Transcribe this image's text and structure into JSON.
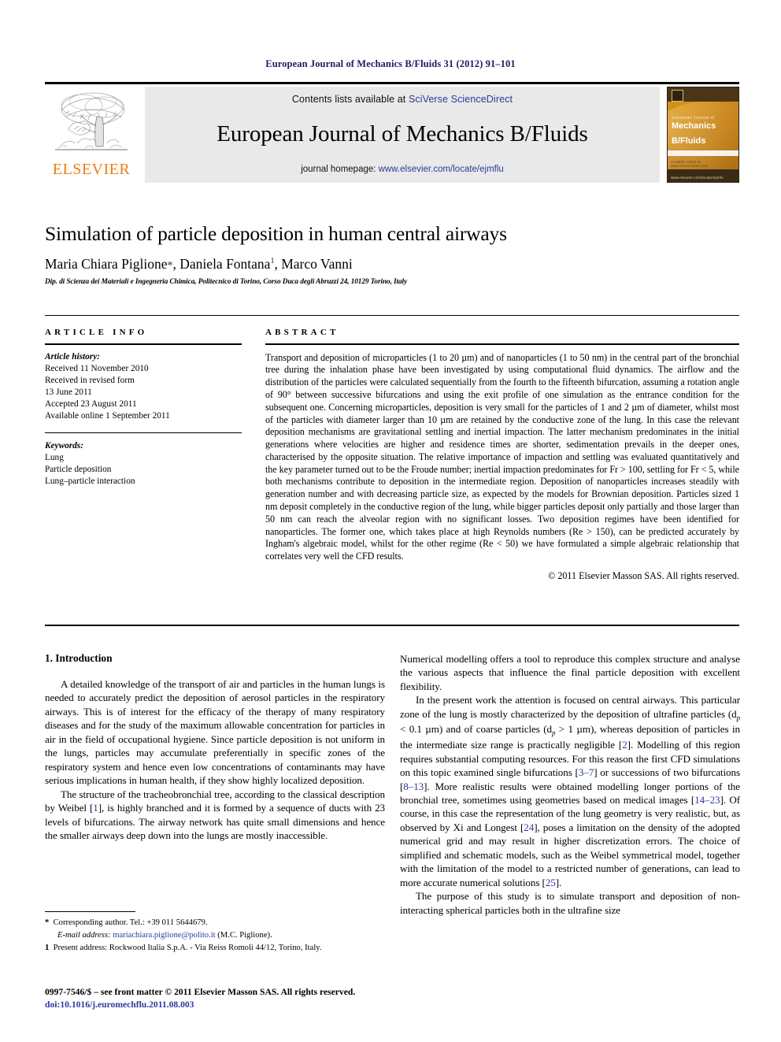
{
  "running_head": "European Journal of Mechanics B/Fluids 31 (2012) 91–101",
  "header": {
    "publisher_wordmark": "ELSEVIER",
    "contents_prefix": "Contents lists available at ",
    "contents_link": "SciVerse ScienceDirect",
    "journal_title": "European Journal of Mechanics B/Fluids",
    "homepage_prefix": "journal homepage: ",
    "homepage_link": "www.elsevier.com/locate/ejmflu",
    "cover": {
      "line1": "European Journal of",
      "line2": "Mechanics",
      "line3": "B/Fluids",
      "foot_small": "www.elsevier.com/locate/ejmflu",
      "foot_tiny": "Available online at www.sciencedirect.com"
    },
    "link_color": "#2b3a9c",
    "elsevier_orange": "#ef7d12",
    "banner_bg": "#e9e9e9"
  },
  "title": "Simulation of particle deposition in human central airways",
  "authors": {
    "a1": "Maria Chiara Piglione",
    "a1_mark": "*",
    "a2": "Daniela Fontana",
    "a2_mark": "1",
    "a3": "Marco Vanni"
  },
  "affiliation": "Dip. di Scienza dei Materiali e Ingegneria Chimica, Politecnico di Torino, Corso Duca degli Abruzzi 24, 10129 Torino, Italy",
  "article_info": {
    "label": "ARTICLE INFO",
    "history_label": "Article history:",
    "history": [
      "Received 11 November 2010",
      "Received in revised form",
      "13 June 2011",
      "Accepted 23 August 2011",
      "Available online 1 September 2011"
    ],
    "keywords_label": "Keywords:",
    "keywords": [
      "Lung",
      "Particle deposition",
      "Lung–particle interaction"
    ]
  },
  "abstract": {
    "label": "ABSTRACT",
    "text": "Transport and deposition of microparticles (1 to 20 µm) and of nanoparticles (1 to 50 nm) in the central part of the bronchial tree during the inhalation phase have been investigated by using computational fluid dynamics. The airflow and the distribution of the particles were calculated sequentially from the fourth to the fifteenth bifurcation, assuming a rotation angle of 90° between successive bifurcations and using the exit profile of one simulation as the entrance condition for the subsequent one. Concerning microparticles, deposition is very small for the particles of 1 and 2 µm of diameter, whilst most of the particles with diameter larger than 10 µm are retained by the conductive zone of the lung. In this case the relevant deposition mechanisms are gravitational settling and inertial impaction. The latter mechanism predominates in the initial generations where velocities are higher and residence times are shorter, sedimentation prevails in the deeper ones, characterised by the opposite situation. The relative importance of impaction and settling was evaluated quantitatively and the key parameter turned out to be the Froude number; inertial impaction predominates for Fr > 100, settling for Fr < 5, while both mechanisms contribute to deposition in the intermediate region. Deposition of nanoparticles increases steadily with generation number and with decreasing particle size, as expected by the models for Brownian deposition. Particles sized 1 nm deposit completely in the conductive region of the lung, while bigger particles deposit only partially and those larger than 50 nm can reach the alveolar region with no significant losses. Two deposition regimes have been identified for nanoparticles. The former one, which takes place at high Reynolds numbers (Re > 150), can be predicted accurately by Ingham's algebraic model, whilst for the other regime (Re < 50) we have formulated a simple algebraic relationship that correlates very well the CFD results.",
    "copyright": "© 2011 Elsevier Masson SAS. All rights reserved."
  },
  "body": {
    "section_heading": "1. Introduction",
    "left_p1": "A detailed knowledge of the transport of air and particles in the human lungs is needed to accurately predict the deposition of aerosol particles in the respiratory airways. This is of interest for the efficacy of the therapy of many respiratory diseases and for the study of the maximum allowable concentration for particles in air in the field of occupational hygiene. Since particle deposition is not uniform in the lungs, particles may accumulate preferentially in specific zones of the respiratory system and hence even low concentrations of contaminants may have serious implications in human health, if they show highly localized deposition.",
    "left_p2_a": "The structure of the tracheobronchial tree, according to the classical description by Weibel [",
    "left_p2_ref1": "1",
    "left_p2_b": "], is highly branched and it is formed by a sequence of ducts with 23 levels of bifurcations. The airway network has quite small dimensions and hence the smaller airways deep down into the lungs are mostly inaccessible.",
    "right_p1": "Numerical modelling offers a tool to reproduce this complex structure and analyse the various aspects that influence the final particle deposition with excellent flexibility.",
    "right_p2_a": "In the present work the attention is focused on central airways. This particular zone of the lung is mostly characterized by the deposition of ultrafine particles (d",
    "right_p2_sub1": "p",
    "right_p2_b": " < 0.1 µm) and of coarse particles (d",
    "right_p2_sub2": "p",
    "right_p2_c": " > 1 µm), whereas deposition of particles in the intermediate size range is practically negligible [",
    "right_p2_ref1": "2",
    "right_p2_d": "]. Modelling of this region requires substantial computing resources. For this reason the first CFD simulations on this topic examined single bifurcations [",
    "right_p2_ref2": "3–7",
    "right_p2_e": "] or successions of two bifurcations [",
    "right_p2_ref3": "8–13",
    "right_p2_f": "]. More realistic results were obtained modelling longer portions of the bronchial tree, sometimes using geometries based on medical images [",
    "right_p2_ref4": "14–23",
    "right_p2_g": "]. Of course, in this case the representation of the lung geometry is very realistic, but, as observed by Xi and Longest [",
    "right_p2_ref5": "24",
    "right_p2_h": "], poses a limitation on the density of the adopted numerical grid and may result in higher discretization errors. The choice of simplified and schematic models, such as the Weibel symmetrical model, together with the limitation of the model to a restricted number of generations, can lead to more accurate numerical solutions [",
    "right_p2_ref6": "25",
    "right_p2_i": "].",
    "right_p3": "The purpose of this study is to simulate transport and deposition of non-interacting spherical particles both in the ultrafine size"
  },
  "footnotes": {
    "corresponding_mark": "*",
    "corresponding_text": "Corresponding author. Tel.: +39 011 5644679.",
    "email_label": "E-mail address:",
    "email": "mariachiara.piglione@polito.it",
    "email_owner": "(M.C. Piglione).",
    "present_mark": "1",
    "present_text": "Present address: Rockwood Italia S.p.A. - Via Reiss Romoli 44/12, Torino, Italy."
  },
  "imprint": {
    "issn_line": "0997-7546/$ – see front matter © 2011 Elsevier Masson SAS. All rights reserved.",
    "doi_line": "doi:10.1016/j.euromechflu.2011.08.003"
  }
}
